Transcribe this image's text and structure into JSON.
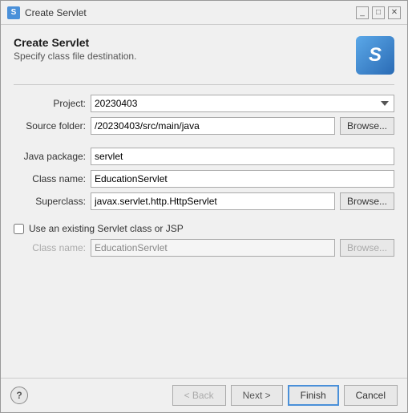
{
  "titleBar": {
    "icon": "S",
    "title": "Create Servlet",
    "minimizeLabel": "_",
    "maximizeLabel": "□",
    "closeLabel": "✕"
  },
  "header": {
    "title": "Create Servlet",
    "subtitle": "Specify class file destination.",
    "logo": "S"
  },
  "form": {
    "projectLabel": "Project:",
    "projectValue": "20230403",
    "sourceFolderLabel": "Source folder:",
    "sourceFolderValue": "/20230403/src/main/java",
    "javaPackageLabel": "Java package:",
    "javaPackageValue": "servlet",
    "classNameLabel": "Class name:",
    "classNameValue": "EducationServlet",
    "superclassLabel": "Superclass:",
    "superclassValue": "javax.servlet.http.HttpServlet",
    "checkboxLabel": "Use an existing Servlet class or JSP",
    "existingClassLabel": "Class name:",
    "existingClassValue": "EducationServlet",
    "browseLabel": "Browse...",
    "browseLabelDisabled": "Browse..."
  },
  "buttons": {
    "help": "?",
    "back": "< Back",
    "next": "Next >",
    "finish": "Finish",
    "cancel": "Cancel"
  }
}
